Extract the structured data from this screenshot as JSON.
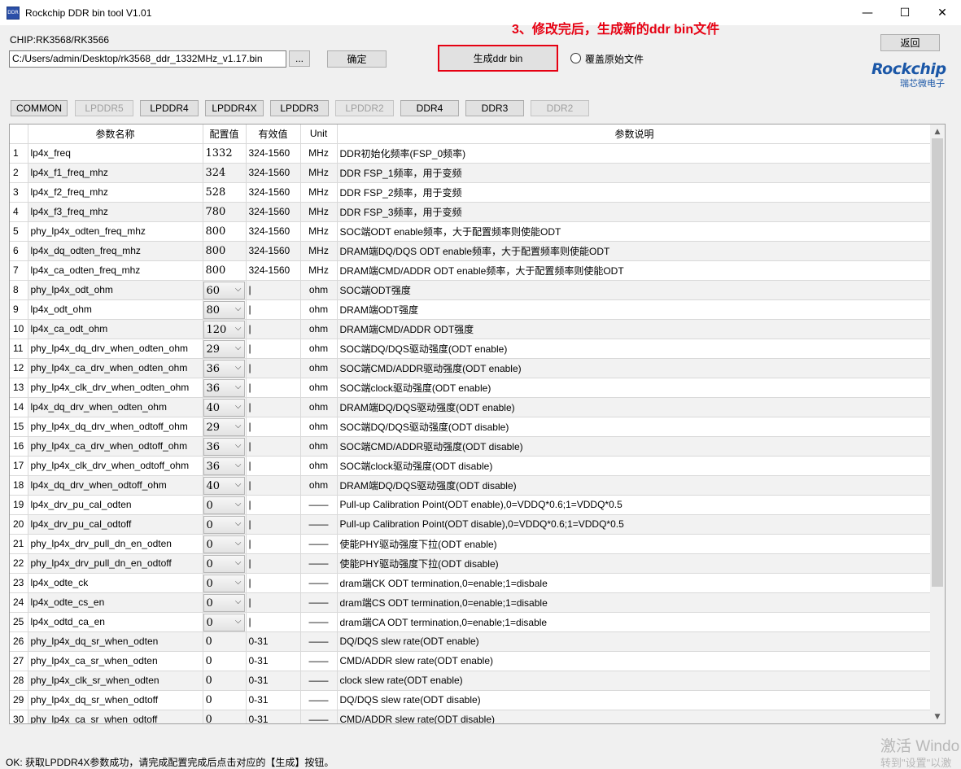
{
  "window": {
    "title": "Rockchip DDR bin tool V1.01",
    "minimize": "—",
    "maximize": "☐",
    "close": "✕",
    "icon": "DDR"
  },
  "chip_label": "CHIP:RK3568/RK3566",
  "file_path": "C:/Users/admin/Desktop/rk3568_ddr_1332MHz_v1.17.bin",
  "browse_label": "...",
  "confirm_label": "确定",
  "generate_label": "生成ddr bin",
  "annotation": "3、修改完后，生成新的ddr bin文件",
  "overwrite_label": "覆盖原始文件",
  "back_label": "返回",
  "logo": {
    "main": "Rockchip",
    "sub": "瑞芯微电子"
  },
  "tabs": [
    {
      "label": "COMMON",
      "enabled": true
    },
    {
      "label": "LPDDR5",
      "enabled": false
    },
    {
      "label": "LPDDR4",
      "enabled": true
    },
    {
      "label": "LPDDR4X",
      "enabled": true
    },
    {
      "label": "LPDDR3",
      "enabled": true
    },
    {
      "label": "LPDDR2",
      "enabled": false
    },
    {
      "label": "DDR4",
      "enabled": true
    },
    {
      "label": "DDR3",
      "enabled": true
    },
    {
      "label": "DDR2",
      "enabled": false
    }
  ],
  "columns": [
    "",
    "参数名称",
    "配置值",
    "有效值",
    "Unit",
    "参数说明"
  ],
  "rows": [
    {
      "idx": "1",
      "name": "lp4x_freq",
      "value": "1332",
      "combo": false,
      "range": "324-1560",
      "unit": "MHz",
      "desc": "DDR初始化频率(FSP_0频率)"
    },
    {
      "idx": "2",
      "name": "lp4x_f1_freq_mhz",
      "value": "324",
      "combo": false,
      "range": "324-1560",
      "unit": "MHz",
      "desc": "DDR FSP_1频率，用于变频"
    },
    {
      "idx": "3",
      "name": "lp4x_f2_freq_mhz",
      "value": "528",
      "combo": false,
      "range": "324-1560",
      "unit": "MHz",
      "desc": "DDR FSP_2频率，用于变频"
    },
    {
      "idx": "4",
      "name": "lp4x_f3_freq_mhz",
      "value": "780",
      "combo": false,
      "range": "324-1560",
      "unit": "MHz",
      "desc": "DDR FSP_3频率，用于变频"
    },
    {
      "idx": "5",
      "name": "phy_lp4x_odten_freq_mhz",
      "value": "800",
      "combo": false,
      "range": "324-1560",
      "unit": "MHz",
      "desc": "SOC端ODT enable频率，大于配置频率则使能ODT"
    },
    {
      "idx": "6",
      "name": "lp4x_dq_odten_freq_mhz",
      "value": "800",
      "combo": false,
      "range": "324-1560",
      "unit": "MHz",
      "desc": "DRAM端DQ/DQS ODT enable频率，大于配置频率则使能ODT"
    },
    {
      "idx": "7",
      "name": "lp4x_ca_odten_freq_mhz",
      "value": "800",
      "combo": false,
      "range": "324-1560",
      "unit": "MHz",
      "desc": "DRAM端CMD/ADDR ODT enable频率，大于配置频率则使能ODT"
    },
    {
      "idx": "8",
      "name": "phy_lp4x_odt_ohm",
      "value": "60",
      "combo": true,
      "range": "|",
      "unit": "ohm",
      "desc": "SOC端ODT强度"
    },
    {
      "idx": "9",
      "name": "lp4x_odt_ohm",
      "value": "80",
      "combo": true,
      "range": "|",
      "unit": "ohm",
      "desc": "DRAM端ODT强度"
    },
    {
      "idx": "10",
      "name": "lp4x_ca_odt_ohm",
      "value": "120",
      "combo": true,
      "range": "|",
      "unit": "ohm",
      "desc": "DRAM端CMD/ADDR ODT强度"
    },
    {
      "idx": "11",
      "name": "phy_lp4x_dq_drv_when_odten_ohm",
      "value": "29",
      "combo": true,
      "range": "|",
      "unit": "ohm",
      "desc": "SOC端DQ/DQS驱动强度(ODT enable)"
    },
    {
      "idx": "12",
      "name": "phy_lp4x_ca_drv_when_odten_ohm",
      "value": "36",
      "combo": true,
      "range": "|",
      "unit": "ohm",
      "desc": "SOC端CMD/ADDR驱动强度(ODT enable)"
    },
    {
      "idx": "13",
      "name": "phy_lp4x_clk_drv_when_odten_ohm",
      "value": "36",
      "combo": true,
      "range": "|",
      "unit": "ohm",
      "desc": "SOC端clock驱动强度(ODT enable)"
    },
    {
      "idx": "14",
      "name": "lp4x_dq_drv_when_odten_ohm",
      "value": "40",
      "combo": true,
      "range": "|",
      "unit": "ohm",
      "desc": "DRAM端DQ/DQS驱动强度(ODT enable)"
    },
    {
      "idx": "15",
      "name": "phy_lp4x_dq_drv_when_odtoff_ohm",
      "value": "29",
      "combo": true,
      "range": "|",
      "unit": "ohm",
      "desc": "SOC端DQ/DQS驱动强度(ODT disable)"
    },
    {
      "idx": "16",
      "name": "phy_lp4x_ca_drv_when_odtoff_ohm",
      "value": "36",
      "combo": true,
      "range": "|",
      "unit": "ohm",
      "desc": "SOC端CMD/ADDR驱动强度(ODT disable)"
    },
    {
      "idx": "17",
      "name": "phy_lp4x_clk_drv_when_odtoff_ohm",
      "value": "36",
      "combo": true,
      "range": "|",
      "unit": "ohm",
      "desc": "SOC端clock驱动强度(ODT disable)"
    },
    {
      "idx": "18",
      "name": "lp4x_dq_drv_when_odtoff_ohm",
      "value": "40",
      "combo": true,
      "range": "|",
      "unit": "ohm",
      "desc": "DRAM端DQ/DQS驱动强度(ODT disable)"
    },
    {
      "idx": "19",
      "name": "lp4x_drv_pu_cal_odten",
      "value": "0",
      "combo": true,
      "range": "|",
      "unit": "——",
      "desc": "Pull-up Calibration Point(ODT enable),0=VDDQ*0.6;1=VDDQ*0.5"
    },
    {
      "idx": "20",
      "name": "lp4x_drv_pu_cal_odtoff",
      "value": "0",
      "combo": true,
      "range": "|",
      "unit": "——",
      "desc": "Pull-up Calibration Point(ODT disable),0=VDDQ*0.6;1=VDDQ*0.5"
    },
    {
      "idx": "21",
      "name": "phy_lp4x_drv_pull_dn_en_odten",
      "value": "0",
      "combo": true,
      "range": "|",
      "unit": "——",
      "desc": "使能PHY驱动强度下拉(ODT enable)"
    },
    {
      "idx": "22",
      "name": "phy_lp4x_drv_pull_dn_en_odtoff",
      "value": "0",
      "combo": true,
      "range": "|",
      "unit": "——",
      "desc": "使能PHY驱动强度下拉(ODT disable)"
    },
    {
      "idx": "23",
      "name": "lp4x_odte_ck",
      "value": "0",
      "combo": true,
      "range": "|",
      "unit": "——",
      "desc": "dram端CK ODT termination,0=enable;1=disbale"
    },
    {
      "idx": "24",
      "name": "lp4x_odte_cs_en",
      "value": "0",
      "combo": true,
      "range": "|",
      "unit": "——",
      "desc": "dram端CS ODT termination,0=enable;1=disable"
    },
    {
      "idx": "25",
      "name": "lp4x_odtd_ca_en",
      "value": "0",
      "combo": true,
      "range": "|",
      "unit": "——",
      "desc": "dram端CA ODT termination,0=enable;1=disable"
    },
    {
      "idx": "26",
      "name": "phy_lp4x_dq_sr_when_odten",
      "value": "0",
      "combo": false,
      "range": "0-31",
      "unit": "——",
      "desc": "DQ/DQS slew rate(ODT enable)"
    },
    {
      "idx": "27",
      "name": "phy_lp4x_ca_sr_when_odten",
      "value": "0",
      "combo": false,
      "range": "0-31",
      "unit": "——",
      "desc": "CMD/ADDR slew rate(ODT enable)"
    },
    {
      "idx": "28",
      "name": "phy_lp4x_clk_sr_when_odten",
      "value": "0",
      "combo": false,
      "range": "0-31",
      "unit": "——",
      "desc": "clock slew rate(ODT enable)"
    },
    {
      "idx": "29",
      "name": "phy_lp4x_dq_sr_when_odtoff",
      "value": "0",
      "combo": false,
      "range": "0-31",
      "unit": "——",
      "desc": "DQ/DQS slew rate(ODT disable)"
    },
    {
      "idx": "30",
      "name": "phy_lp4x_ca_sr_when_odtoff",
      "value": "0",
      "combo": false,
      "range": "0-31",
      "unit": "——",
      "desc": "CMD/ADDR slew rate(ODT disable)"
    }
  ],
  "status_text": "OK: 获取LPDDR4X参数成功，请完成配置完成后点击对应的【生成】按钮。",
  "watermark": {
    "line1": "激活 Windo",
    "line2": "转到\"设置\"以激"
  },
  "colors": {
    "accent": "#e60012",
    "logo": "#1b57a7",
    "disabled_text": "#a0a0a0"
  }
}
